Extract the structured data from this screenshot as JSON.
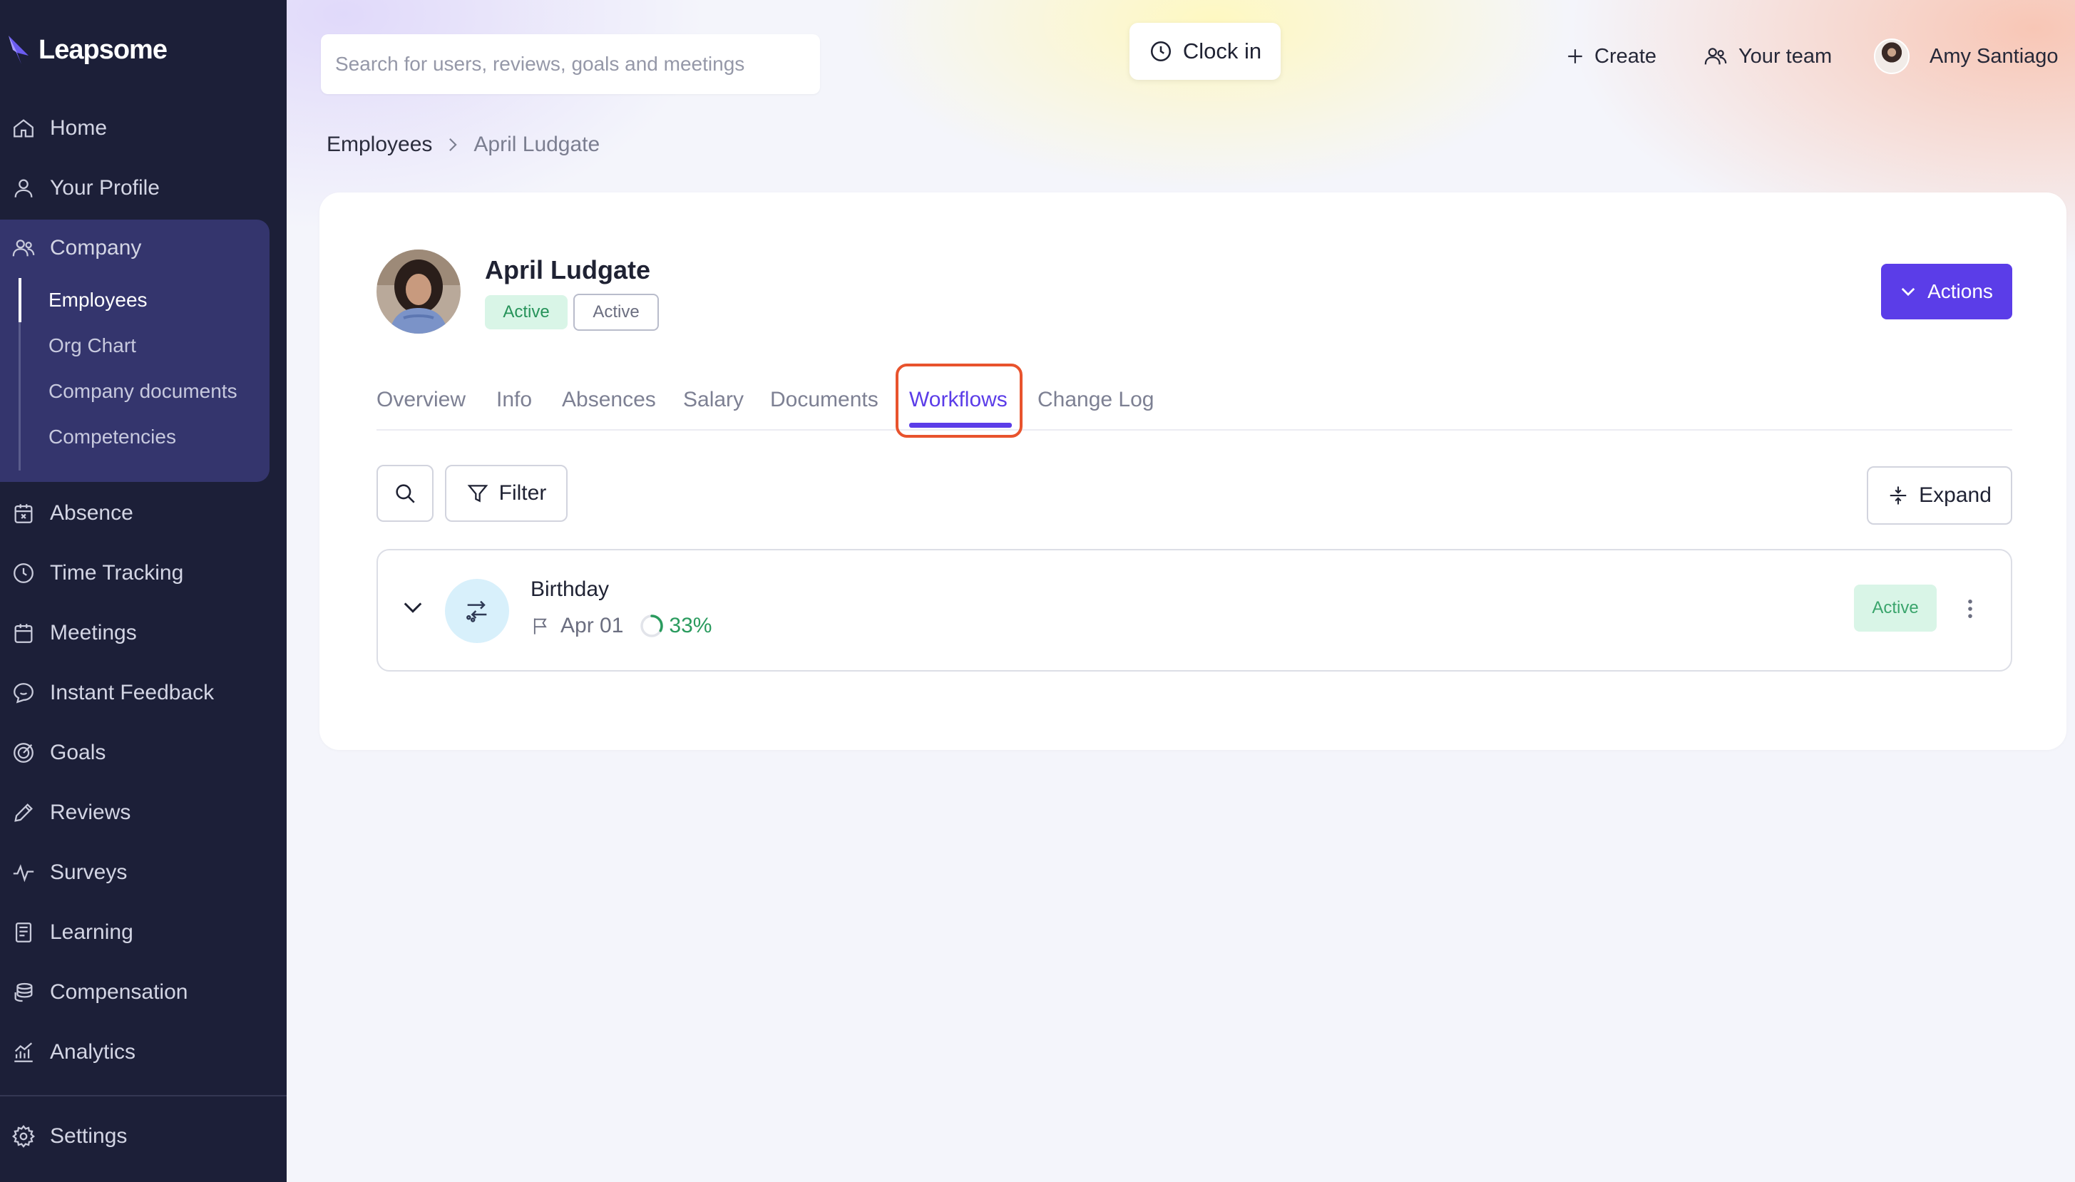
{
  "app": {
    "name": "Leapsome"
  },
  "sidebar": {
    "items": [
      {
        "label": "Home",
        "icon": "home-icon"
      },
      {
        "label": "Your Profile",
        "icon": "user-icon"
      },
      {
        "label": "Company",
        "icon": "users-icon"
      },
      {
        "label": "Absence",
        "icon": "calendar-x-icon"
      },
      {
        "label": "Time Tracking",
        "icon": "clock-icon"
      },
      {
        "label": "Meetings",
        "icon": "calendar-icon"
      },
      {
        "label": "Instant Feedback",
        "icon": "chat-smile-icon"
      },
      {
        "label": "Goals",
        "icon": "target-icon"
      },
      {
        "label": "Reviews",
        "icon": "pencil-icon"
      },
      {
        "label": "Surveys",
        "icon": "pulse-icon"
      },
      {
        "label": "Learning",
        "icon": "book-icon"
      },
      {
        "label": "Compensation",
        "icon": "coins-icon"
      },
      {
        "label": "Analytics",
        "icon": "analytics-icon"
      },
      {
        "label": "Settings",
        "icon": "gear-icon"
      }
    ],
    "company_sub": [
      "Employees",
      "Org Chart",
      "Company documents",
      "Competencies"
    ],
    "active_item": "Company",
    "active_sub": "Employees"
  },
  "header": {
    "search_placeholder": "Search for users, reviews, goals and meetings",
    "clock_in": "Clock in",
    "create": "Create",
    "your_team": "Your team",
    "user_name": "Amy Santiago"
  },
  "breadcrumb": {
    "parent": "Employees",
    "current": "April Ludgate"
  },
  "profile": {
    "name": "April Ludgate",
    "status_badge": "Active",
    "status_badge_outline": "Active",
    "actions_label": "Actions"
  },
  "tabs": [
    "Overview",
    "Info",
    "Absences",
    "Salary",
    "Documents",
    "Workflows",
    "Change Log"
  ],
  "active_tab": "Workflows",
  "toolbar": {
    "filter_label": "Filter",
    "expand_label": "Expand"
  },
  "workflow": {
    "title": "Birthday",
    "date": "Apr 01",
    "progress_label": "33%",
    "progress": 0.33,
    "status": "Active"
  },
  "colors": {
    "sidebar_bg": "#1c1f38",
    "company_block": "#34356d",
    "accent": "#5b3de8",
    "success": "#26935a",
    "success_bg": "#d9f5e7",
    "highlight": "#e8532d"
  }
}
